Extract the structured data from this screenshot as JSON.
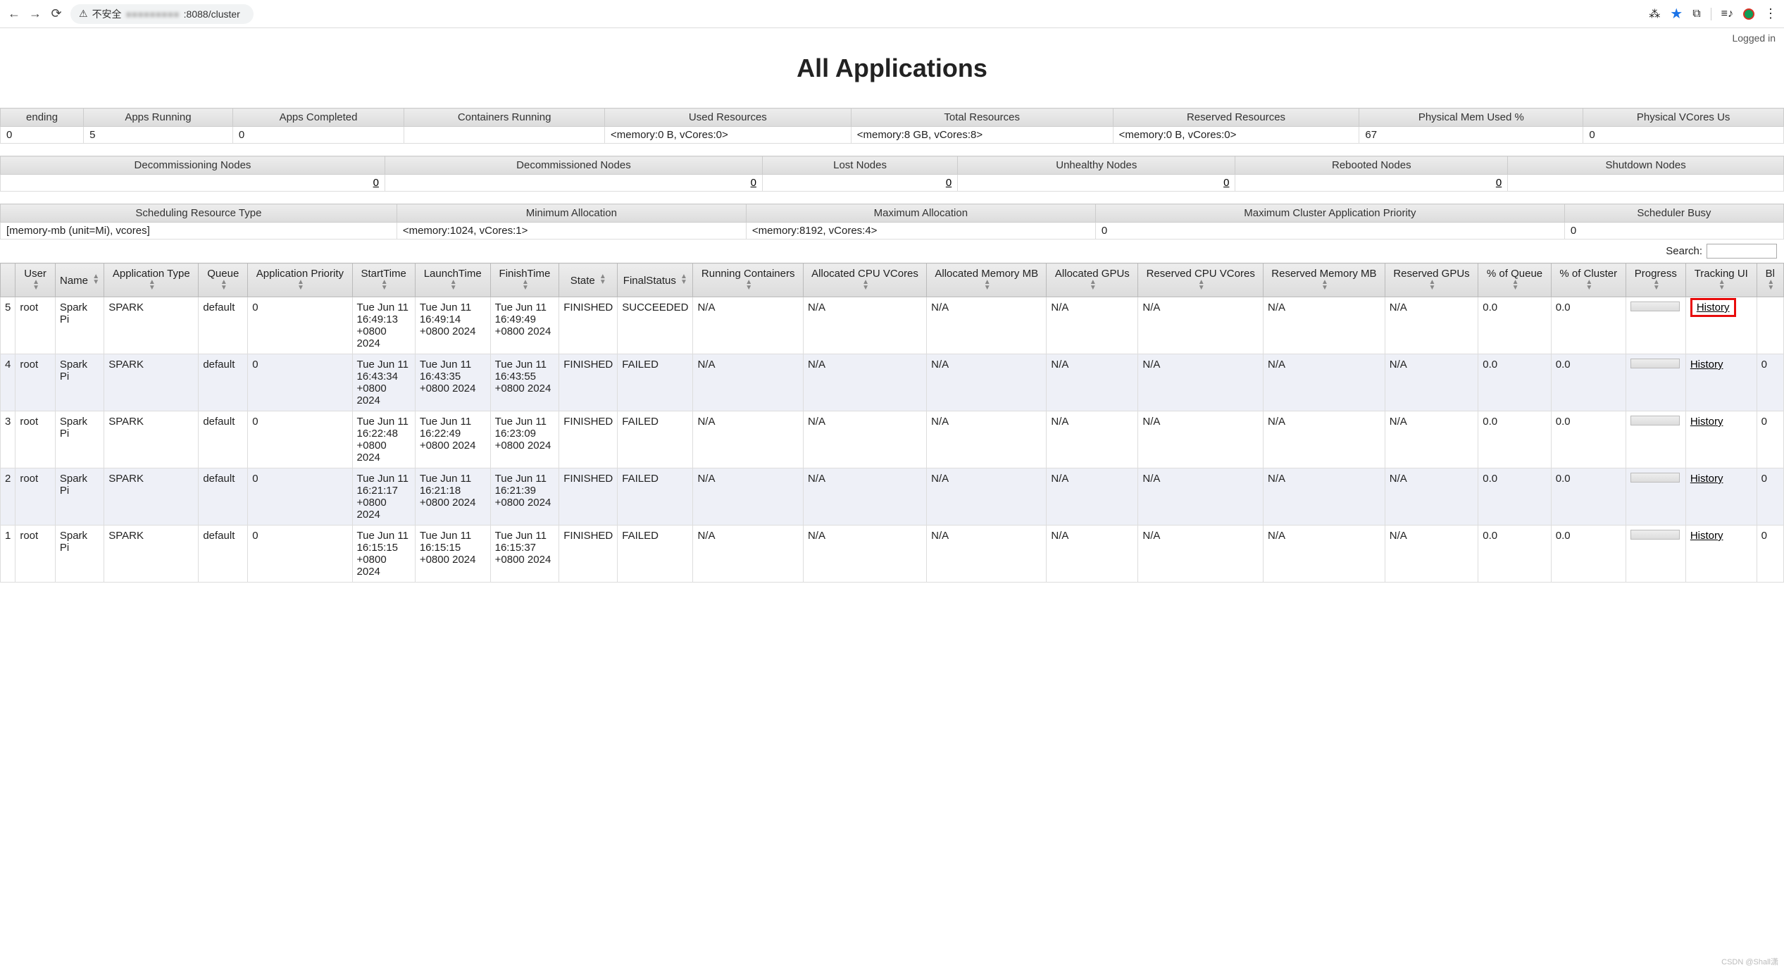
{
  "browser": {
    "insecure_label": "不安全",
    "url_suffix": ":8088/cluster"
  },
  "header": {
    "logged_in": "Logged in",
    "title": "All Applications"
  },
  "cluster_metrics": {
    "headers": [
      "ending",
      "Apps Running",
      "Apps Completed",
      "Containers Running",
      "Used Resources",
      "Total Resources",
      "Reserved Resources",
      "Physical Mem Used %",
      "Physical VCores Us"
    ],
    "values": [
      "0",
      "5",
      "0",
      "",
      "<memory:0 B, vCores:0>",
      "<memory:8 GB, vCores:8>",
      "<memory:0 B, vCores:0>",
      "67",
      "0"
    ]
  },
  "node_metrics": {
    "headers": [
      "Decommissioning Nodes",
      "Decommissioned Nodes",
      "Lost Nodes",
      "Unhealthy Nodes",
      "Rebooted Nodes",
      "Shutdown Nodes"
    ],
    "values": [
      "0",
      "0",
      "0",
      "0",
      "0",
      ""
    ]
  },
  "sched_metrics": {
    "headers": [
      "Scheduling Resource Type",
      "Minimum Allocation",
      "Maximum Allocation",
      "Maximum Cluster Application Priority",
      "Scheduler Busy"
    ],
    "values": [
      "[memory-mb (unit=Mi), vcores]",
      "<memory:1024, vCores:1>",
      "<memory:8192, vCores:4>",
      "0",
      "0"
    ]
  },
  "search_label": "Search:",
  "apps": {
    "headers": [
      "",
      "User",
      "Name",
      "Application Type",
      "Queue",
      "Application Priority",
      "StartTime",
      "LaunchTime",
      "FinishTime",
      "State",
      "FinalStatus",
      "Running Containers",
      "Allocated CPU VCores",
      "Allocated Memory MB",
      "Allocated GPUs",
      "Reserved CPU VCores",
      "Reserved Memory MB",
      "Reserved GPUs",
      "% of Queue",
      "% of Cluster",
      "Progress",
      "Tracking UI",
      "Bl"
    ],
    "rows": [
      {
        "idx": "5",
        "user": "root",
        "name": "Spark Pi",
        "apptype": "SPARK",
        "queue": "default",
        "priority": "0",
        "start": "Tue Jun 11 16:49:13 +0800 2024",
        "launch": "Tue Jun 11 16:49:14 +0800 2024",
        "finish": "Tue Jun 11 16:49:49 +0800 2024",
        "state": "FINISHED",
        "final": "SUCCEEDED",
        "rc": "N/A",
        "acpu": "N/A",
        "amem": "N/A",
        "agpu": "N/A",
        "rcpu": "N/A",
        "rmem": "N/A",
        "rgpu": "N/A",
        "pq": "0.0",
        "pc": "0.0",
        "tracking": "History",
        "highlight": true,
        "bl": ""
      },
      {
        "idx": "4",
        "user": "root",
        "name": "Spark Pi",
        "apptype": "SPARK",
        "queue": "default",
        "priority": "0",
        "start": "Tue Jun 11 16:43:34 +0800 2024",
        "launch": "Tue Jun 11 16:43:35 +0800 2024",
        "finish": "Tue Jun 11 16:43:55 +0800 2024",
        "state": "FINISHED",
        "final": "FAILED",
        "rc": "N/A",
        "acpu": "N/A",
        "amem": "N/A",
        "agpu": "N/A",
        "rcpu": "N/A",
        "rmem": "N/A",
        "rgpu": "N/A",
        "pq": "0.0",
        "pc": "0.0",
        "tracking": "History",
        "bl": "0"
      },
      {
        "idx": "3",
        "user": "root",
        "name": "Spark Pi",
        "apptype": "SPARK",
        "queue": "default",
        "priority": "0",
        "start": "Tue Jun 11 16:22:48 +0800 2024",
        "launch": "Tue Jun 11 16:22:49 +0800 2024",
        "finish": "Tue Jun 11 16:23:09 +0800 2024",
        "state": "FINISHED",
        "final": "FAILED",
        "rc": "N/A",
        "acpu": "N/A",
        "amem": "N/A",
        "agpu": "N/A",
        "rcpu": "N/A",
        "rmem": "N/A",
        "rgpu": "N/A",
        "pq": "0.0",
        "pc": "0.0",
        "tracking": "History",
        "bl": "0"
      },
      {
        "idx": "2",
        "user": "root",
        "name": "Spark Pi",
        "apptype": "SPARK",
        "queue": "default",
        "priority": "0",
        "start": "Tue Jun 11 16:21:17 +0800 2024",
        "launch": "Tue Jun 11 16:21:18 +0800 2024",
        "finish": "Tue Jun 11 16:21:39 +0800 2024",
        "state": "FINISHED",
        "final": "FAILED",
        "rc": "N/A",
        "acpu": "N/A",
        "amem": "N/A",
        "agpu": "N/A",
        "rcpu": "N/A",
        "rmem": "N/A",
        "rgpu": "N/A",
        "pq": "0.0",
        "pc": "0.0",
        "tracking": "History",
        "bl": "0"
      },
      {
        "idx": "1",
        "user": "root",
        "name": "Spark Pi",
        "apptype": "SPARK",
        "queue": "default",
        "priority": "0",
        "start": "Tue Jun 11 16:15:15 +0800 2024",
        "launch": "Tue Jun 11 16:15:15 +0800 2024",
        "finish": "Tue Jun 11 16:15:37 +0800 2024",
        "state": "FINISHED",
        "final": "FAILED",
        "rc": "N/A",
        "acpu": "N/A",
        "amem": "N/A",
        "agpu": "N/A",
        "rcpu": "N/A",
        "rmem": "N/A",
        "rgpu": "N/A",
        "pq": "0.0",
        "pc": "0.0",
        "tracking": "History",
        "bl": "0"
      }
    ]
  },
  "watermark": "CSDN @Shall潇"
}
